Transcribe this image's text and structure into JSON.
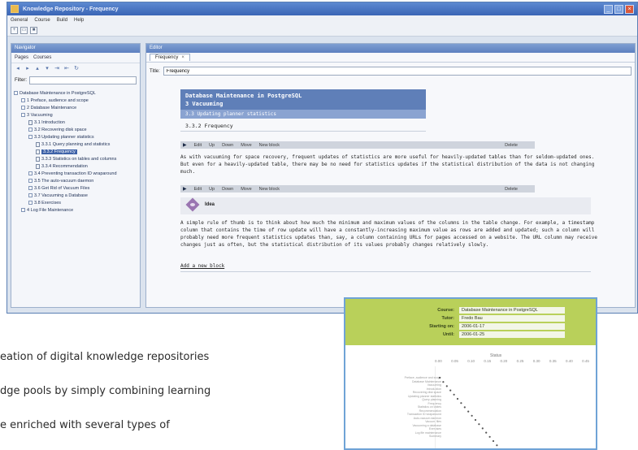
{
  "window": {
    "title": "Knowledge Repository - Frequency"
  },
  "menu": [
    "General",
    "Course",
    "Build",
    "Help"
  ],
  "navigator": {
    "header": "Navigator",
    "tabs": [
      "Pages",
      "Courses"
    ],
    "filter_label": "Filter:",
    "filter_value": "",
    "tree": [
      {
        "label": "Database Maintenance in PostgreSQL",
        "level": 0,
        "type": "node"
      },
      {
        "label": "1 Preface, audience and scope",
        "level": 1,
        "type": "node"
      },
      {
        "label": "2 Database Maintenance",
        "level": 1,
        "type": "node"
      },
      {
        "label": "3 Vacuuming",
        "level": 1,
        "type": "node"
      },
      {
        "label": "3.1 Introduction",
        "level": 2,
        "type": "doc"
      },
      {
        "label": "3.2 Recovering disk space",
        "level": 2,
        "type": "node"
      },
      {
        "label": "3.3 Updating planner statistics",
        "level": 2,
        "type": "node"
      },
      {
        "label": "3.3.1 Query planning and statistics",
        "level": 3,
        "type": "doc"
      },
      {
        "label": "3.3.2 Frequency",
        "level": 3,
        "type": "doc",
        "selected": true
      },
      {
        "label": "3.3.3 Statistics on tables and columns",
        "level": 3,
        "type": "doc"
      },
      {
        "label": "3.3.4 Recommendation",
        "level": 3,
        "type": "doc"
      },
      {
        "label": "3.4 Preventing transaction ID wraparound",
        "level": 2,
        "type": "node"
      },
      {
        "label": "3.5 The auto-vacuum daemon",
        "level": 2,
        "type": "node"
      },
      {
        "label": "3.6 Get Rid of Vacuum Files",
        "level": 2,
        "type": "node"
      },
      {
        "label": "3.7 Vacuuming a Database",
        "level": 2,
        "type": "node"
      },
      {
        "label": "3.8 Exercises",
        "level": 2,
        "type": "node"
      },
      {
        "label": "4 Log File Maintenance",
        "level": 1,
        "type": "node"
      }
    ]
  },
  "editor": {
    "header": "Editor",
    "tab_label": "Frequency",
    "title_label": "Title:",
    "title_value": "Frequency",
    "heading1": "Database Maintenance in PostgreSQL",
    "heading2": "3 Vacuuming",
    "heading3": "3.3 Updating planner statistics",
    "subheading": "3.3.2 Frequency",
    "blockbar1": {
      "edit": "Edit",
      "up": "Up",
      "down": "Down",
      "move": "Move",
      "new": "New block",
      "delete": "Delete"
    },
    "para1": "As with vacuuming for space recovery, frequent updates of statistics are more useful for heavily-updated tables than for seldom-updated ones. But even for a heavily-updated table, there may be no need for statistics updates if the statistical distribution of the data is not changing much.",
    "blockbar2": {
      "edit": "Edit",
      "up": "Up",
      "down": "Down",
      "move": "Move",
      "new": "New block",
      "delete": "Delete"
    },
    "callout_title": "Idea",
    "para2": "A simple rule of thumb is to think about how much the minimum and maximum values of the columns in the table change. For example, a timestamp column that contains the time of row update will have a constantly-increasing maximum value as rows are added and updated; such a column will probably need more frequent statistics updates than, say, a column containing URLs for pages accessed on a website. The URL column may receive changes just as often, but the statistical distribution of its values probably changes relatively slowly.",
    "add_link": "Add a new block"
  },
  "report": {
    "fields": [
      {
        "key": "Course:",
        "value": "Database Maintenance in PostgreSQL"
      },
      {
        "key": "Tutor:",
        "value": "Fredo Bau"
      },
      {
        "key": "Starting on:",
        "value": "2006-01-17"
      },
      {
        "key": "Until:",
        "value": "2006-01-25"
      }
    ],
    "axis_title": "Status",
    "ticks": [
      "0.00",
      "0.05",
      "0.10",
      "0.15",
      "0.20",
      "0.25",
      "0.30",
      "0.35",
      "0.40",
      "0.45"
    ],
    "row_labels": [
      "Preface, audience and scope",
      "Database Maintenance",
      "Vacuuming",
      "Introduction",
      "Recovering disk space",
      "Updating planner statistics",
      "Query planning",
      "Frequency",
      "Statistics on tables",
      "Recommendation",
      "Transaction ID wraparound",
      "Auto-vacuum daemon",
      "Vacuum files",
      "Vacuuming a database",
      "Exercises",
      "Log file maintenance",
      "Summary"
    ]
  },
  "page_text": {
    "line1": "eation of digital knowledge repositories",
    "line2": "dge pools by simply combining learning",
    "line3": "e enriched with several types of"
  }
}
